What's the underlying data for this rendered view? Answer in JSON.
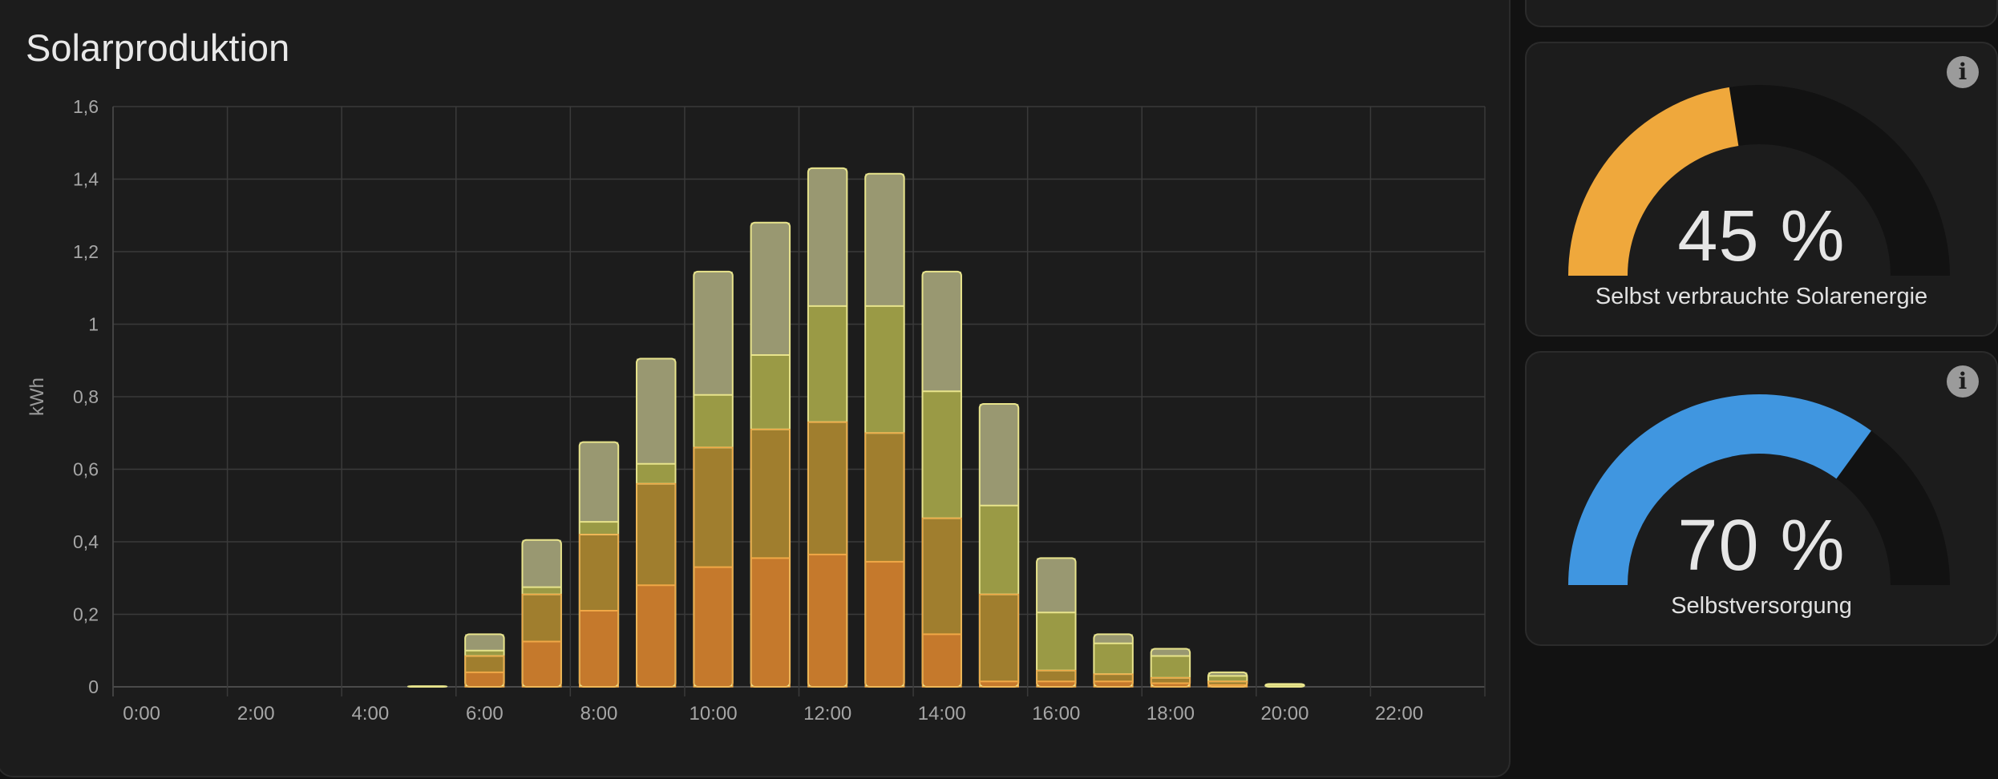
{
  "chart_card": {
    "title": "Solarproduktion"
  },
  "chart_data": {
    "type": "bar",
    "stacked": true,
    "title": "Solarproduktion",
    "ylabel": "kWh",
    "xlabel": "",
    "ylim": [
      0,
      1.6
    ],
    "y_ticks": [
      "0",
      "0,2",
      "0,4",
      "0,6",
      "0,8",
      "1",
      "1,2",
      "1,4",
      "1,6"
    ],
    "x_tick_labels": [
      "0:00",
      "2:00",
      "4:00",
      "6:00",
      "8:00",
      "10:00",
      "12:00",
      "14:00",
      "16:00",
      "18:00",
      "20:00",
      "22:00"
    ],
    "grid": true,
    "hours": [
      0,
      1,
      2,
      3,
      4,
      5,
      6,
      7,
      8,
      9,
      10,
      11,
      12,
      13,
      14,
      15,
      16,
      17,
      18,
      19,
      20,
      21,
      22,
      23
    ],
    "series": [
      {
        "color": "#c5792c",
        "values": [
          0,
          0,
          0,
          0,
          0,
          0,
          0.04,
          0.125,
          0.21,
          0.28,
          0.33,
          0.355,
          0.365,
          0.345,
          0.145,
          0.015,
          0.015,
          0.015,
          0.01,
          0.005,
          0,
          0,
          0,
          0
        ]
      },
      {
        "color": "#a07e2e",
        "values": [
          0,
          0,
          0,
          0,
          0,
          0,
          0.045,
          0.13,
          0.21,
          0.28,
          0.33,
          0.355,
          0.365,
          0.355,
          0.32,
          0.24,
          0.03,
          0.02,
          0.015,
          0.01,
          0,
          0,
          0,
          0
        ]
      },
      {
        "color": "#9a9a45",
        "values": [
          0,
          0,
          0,
          0,
          0,
          0,
          0.015,
          0.02,
          0.035,
          0.055,
          0.145,
          0.205,
          0.32,
          0.35,
          0.35,
          0.245,
          0.16,
          0.085,
          0.06,
          0.015,
          0.005,
          0,
          0,
          0,
          0
        ]
      },
      {
        "color": "#999871",
        "values": [
          0,
          0,
          0,
          0,
          0,
          0.002,
          0.045,
          0.13,
          0.22,
          0.29,
          0.34,
          0.365,
          0.38,
          0.365,
          0.33,
          0.28,
          0.15,
          0.025,
          0.02,
          0.01,
          0.003,
          0,
          0,
          0,
          0
        ]
      }
    ]
  },
  "gauges": [
    {
      "value": 45,
      "display": "45 %",
      "label": "Selbst verbrauchte Solarenergie",
      "color": "#efa83c"
    },
    {
      "value": 70,
      "display": "70 %",
      "label": "Selbstversorgung",
      "color": "#4096e0"
    }
  ],
  "info_icon": "info-icon",
  "colors": {
    "background": "#121212",
    "card": "#1c1c1c",
    "gauge_track": "#121212"
  }
}
